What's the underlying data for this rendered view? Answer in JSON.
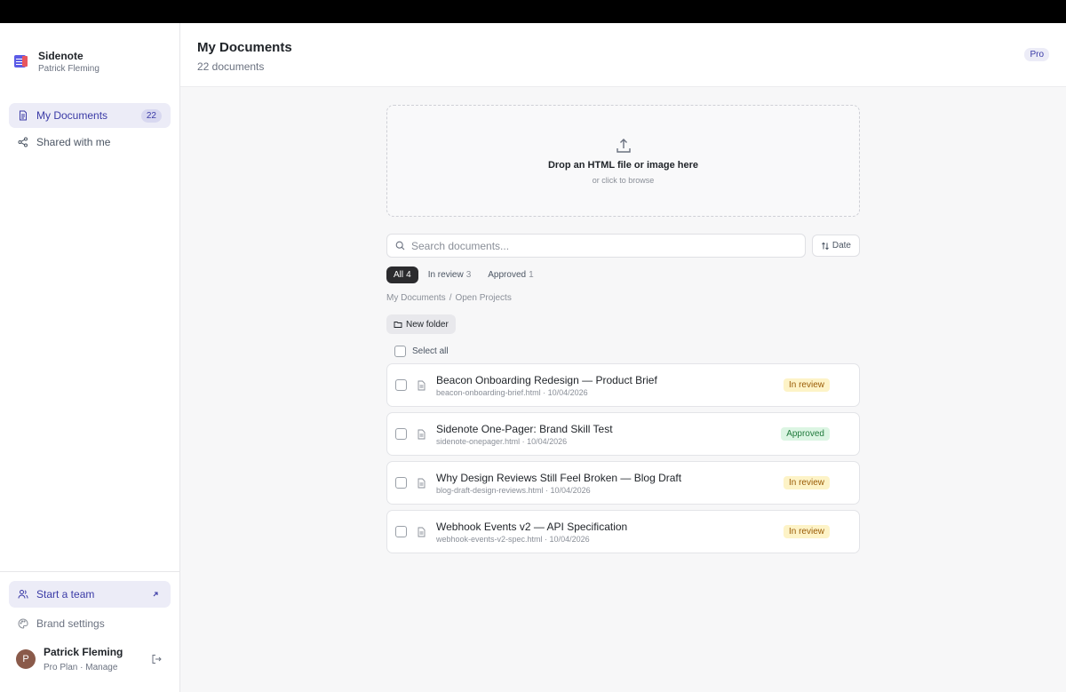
{
  "app": {
    "name": "Sidenote",
    "user": "Patrick Fleming"
  },
  "nav": {
    "items": [
      {
        "label": "My Documents",
        "count": "22"
      },
      {
        "label": "Shared with me"
      }
    ]
  },
  "sidebar_bottom": {
    "team_label": "Start a team",
    "brand_settings_label": "Brand settings",
    "user_name": "Patrick Fleming",
    "user_plan": "Pro Plan · Manage",
    "avatar_initial": "P"
  },
  "header": {
    "title": "My Documents",
    "subtitle": "22 documents",
    "plan_badge": "Pro"
  },
  "dropzone": {
    "title": "Drop an HTML file or image here",
    "subtitle": "or click to browse"
  },
  "search": {
    "placeholder": "Search documents...",
    "sort_label": "Date"
  },
  "filters": [
    {
      "label": "All",
      "count": "4"
    },
    {
      "label": "In review",
      "count": "3"
    },
    {
      "label": "Approved",
      "count": "1"
    }
  ],
  "breadcrumb": {
    "root": "My Documents",
    "separator": "/",
    "current": "Open Projects"
  },
  "new_folder_label": "New folder",
  "select_all_label": "Select all",
  "documents": [
    {
      "title": "Beacon Onboarding Redesign — Product Brief",
      "meta": "beacon-onboarding-brief.html · 10/04/2026",
      "status": "In review"
    },
    {
      "title": "Sidenote One-Pager: Brand Skill Test",
      "meta": "sidenote-onepager.html · 10/04/2026",
      "status": "Approved"
    },
    {
      "title": "Why Design Reviews Still Feel Broken — Blog Draft",
      "meta": "blog-draft-design-reviews.html · 10/04/2026",
      "status": "In review"
    },
    {
      "title": "Webhook Events v2 — API Specification",
      "meta": "webhook-events-v2-spec.html · 10/04/2026",
      "status": "In review"
    }
  ],
  "colors": {
    "accent": "#3a3aa6",
    "accent_bg": "#ececf7",
    "review_bg": "#fdf3c7",
    "approved_bg": "#dcf5e3"
  },
  "icons": {
    "brand": "sidenote-logo-icon",
    "my_documents": "document-icon",
    "shared": "share-icon",
    "team": "users-icon",
    "external": "arrow-up-right-icon",
    "brand_settings": "palette-icon",
    "logout": "logout-icon",
    "upload": "upload-icon",
    "search": "search-icon",
    "sort": "sort-icon",
    "folder": "folder-icon",
    "file": "file-icon"
  }
}
